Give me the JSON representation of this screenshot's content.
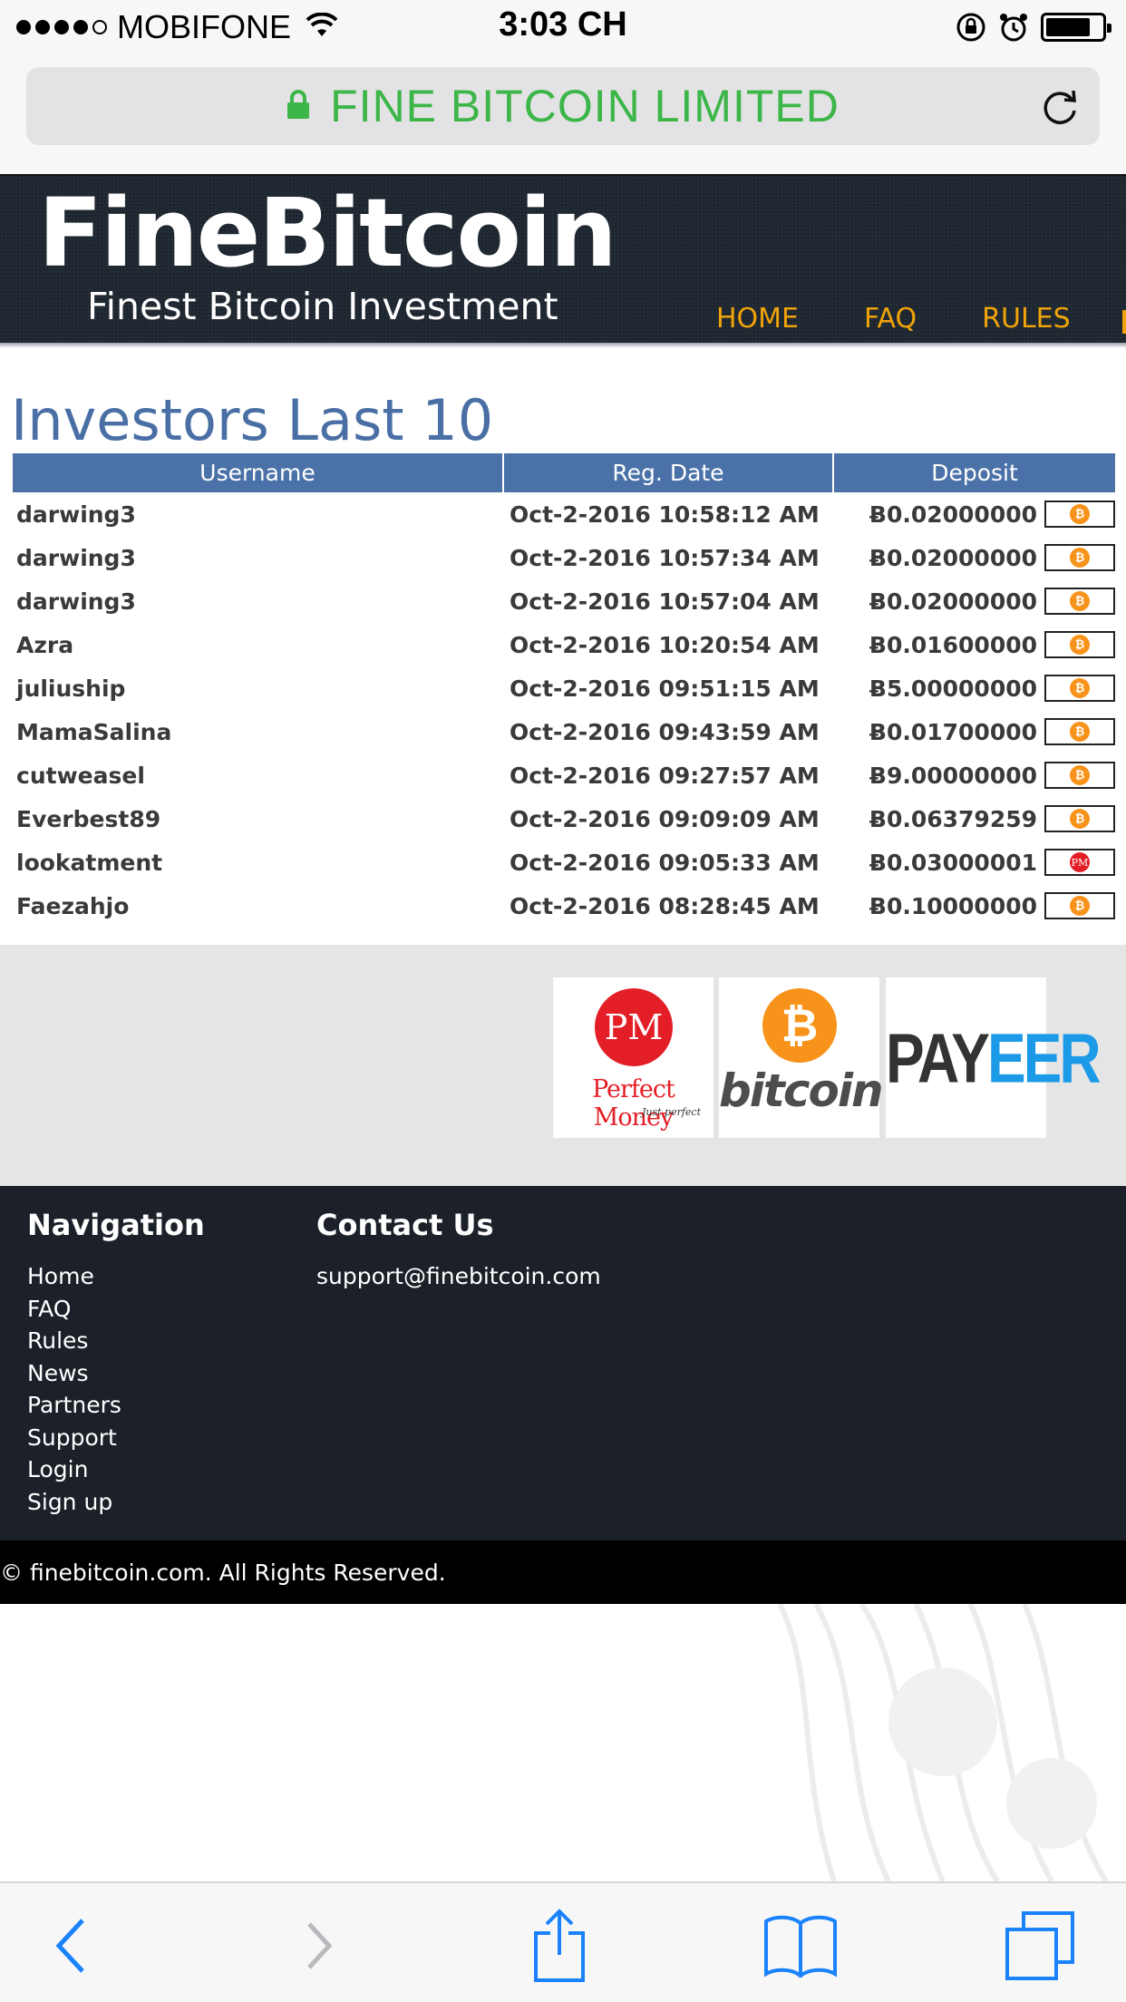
{
  "status_bar": {
    "carrier": "MOBIFONE",
    "time": "3:03 CH"
  },
  "browser": {
    "url_title": "FINE BITCOIN LIMITED"
  },
  "site": {
    "logo": "FineBitcoin",
    "tagline": "Finest Bitcoin Investment",
    "nav": [
      "HOME",
      "FAQ",
      "RULES"
    ]
  },
  "page_title": "Investors Last 10",
  "table": {
    "headers": [
      "Username",
      "Reg. Date",
      "Deposit"
    ],
    "rows": [
      {
        "username": "darwing3",
        "date": "Oct-2-2016 10:58:12 AM",
        "deposit": "Ƀ0.02000000",
        "method": "bitcoin"
      },
      {
        "username": "darwing3",
        "date": "Oct-2-2016 10:57:34 AM",
        "deposit": "Ƀ0.02000000",
        "method": "bitcoin"
      },
      {
        "username": "darwing3",
        "date": "Oct-2-2016 10:57:04 AM",
        "deposit": "Ƀ0.02000000",
        "method": "bitcoin"
      },
      {
        "username": "Azra",
        "date": "Oct-2-2016 10:20:54 AM",
        "deposit": "Ƀ0.01600000",
        "method": "bitcoin"
      },
      {
        "username": "juliuship",
        "date": "Oct-2-2016 09:51:15 AM",
        "deposit": "Ƀ5.00000000",
        "method": "bitcoin"
      },
      {
        "username": "MamaSalina",
        "date": "Oct-2-2016 09:43:59 AM",
        "deposit": "Ƀ0.01700000",
        "method": "bitcoin"
      },
      {
        "username": "cutweasel",
        "date": "Oct-2-2016 09:27:57 AM",
        "deposit": "Ƀ9.00000000",
        "method": "bitcoin"
      },
      {
        "username": "Everbest89",
        "date": "Oct-2-2016 09:09:09 AM",
        "deposit": "Ƀ0.06379259",
        "method": "bitcoin"
      },
      {
        "username": "lookatment",
        "date": "Oct-2-2016 09:05:33 AM",
        "deposit": "Ƀ0.03000001",
        "method": "perfect-money"
      },
      {
        "username": "Faezahjo",
        "date": "Oct-2-2016 08:28:45 AM",
        "deposit": "Ƀ0.10000000",
        "method": "bitcoin"
      }
    ]
  },
  "processors": {
    "perfect_money": {
      "badge": "PM",
      "name": "Perfect Money",
      "sub": "Just perfect"
    },
    "bitcoin": {
      "symbol": "₿",
      "name": "bitcoin"
    },
    "payeer": {
      "part1": "PAY",
      "part2": "EER"
    }
  },
  "footer": {
    "navigation_title": "Navigation",
    "navigation_links": [
      "Home",
      "FAQ",
      "Rules",
      "News",
      "Partners",
      "Support",
      "Login",
      "Sign up"
    ],
    "contact_title": "Contact Us",
    "contact_email": "support@finebitcoin.com",
    "copyright": "© finebitcoin.com. All Rights Reserved."
  },
  "icons": {
    "lock": "lock-icon",
    "reload": "reload-icon",
    "back": "back-arrow-icon",
    "forward": "forward-arrow-icon",
    "share": "share-icon",
    "bookmarks": "bookmarks-icon",
    "tabs": "tabs-icon"
  },
  "colors": {
    "url_green": "#3cb648",
    "nav_orange": "#f0a30a",
    "title_blue": "#4a6fa5",
    "table_header": "#4a72a8",
    "footer_bg": "#1c2129",
    "ios_blue": "#1a82fb"
  }
}
